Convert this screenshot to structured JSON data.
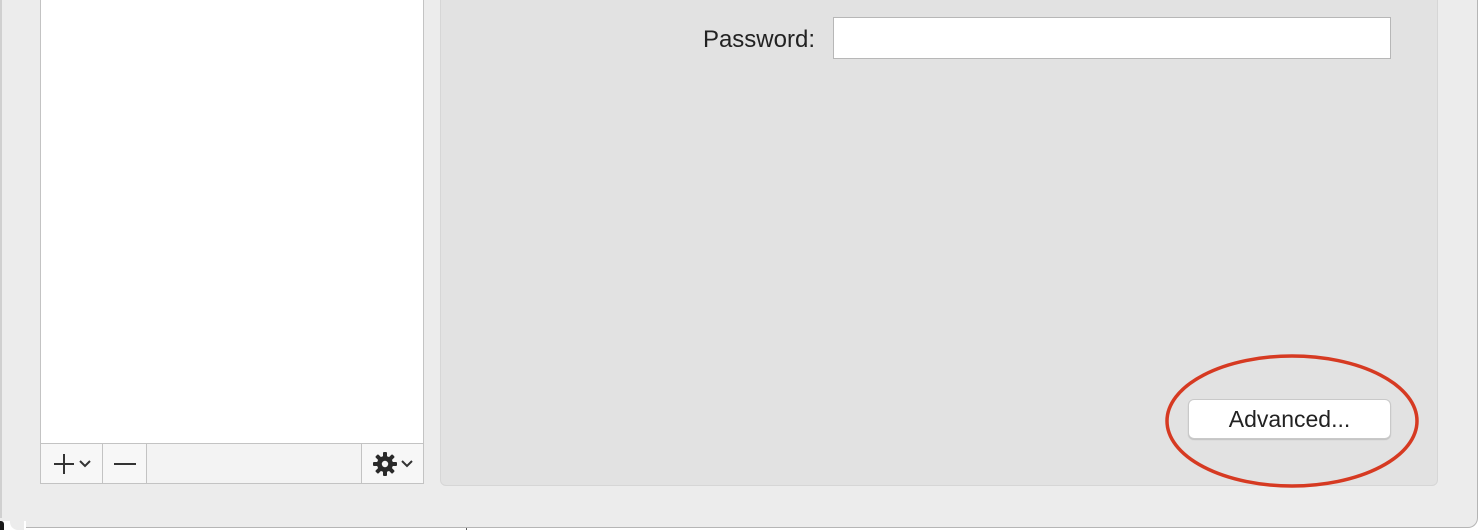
{
  "sidebar": {
    "toolbar": {
      "add_icon": "plus-icon",
      "add_menu_icon": "chevron-down-icon",
      "remove_icon": "minus-icon",
      "action_icon": "gear-icon",
      "action_menu_icon": "chevron-down-icon"
    }
  },
  "main": {
    "password": {
      "label": "Password:",
      "value": ""
    },
    "advanced_button": {
      "label": "Advanced..."
    }
  },
  "annotation": {
    "shape": "ellipse",
    "color": "#d63a22",
    "target": "advanced-button"
  },
  "colors": {
    "window_bg": "#ececec",
    "panel_bg": "#e2e2e2",
    "list_bg": "#ffffff"
  }
}
